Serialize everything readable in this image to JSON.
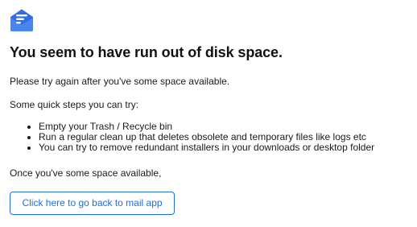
{
  "app": {
    "logo_icon": "mail-envelope-icon",
    "accent_color": "#2f6fe6"
  },
  "error": {
    "title": "You seem to have run out of disk space.",
    "message": "Please try again after you've some space available.",
    "steps_intro": "Some quick steps you can try:",
    "steps": [
      "Empty your Trash / Recycle bin",
      "Run a regular clean up that deletes obsolete and temporary files like logs etc",
      "You can try to remove redundant installers in your downloads or desktop folder"
    ],
    "closing": "Once you've some space available,"
  },
  "actions": {
    "back_button_label": "Click here to go back to mail app",
    "button_color": "#1f6fe0"
  }
}
